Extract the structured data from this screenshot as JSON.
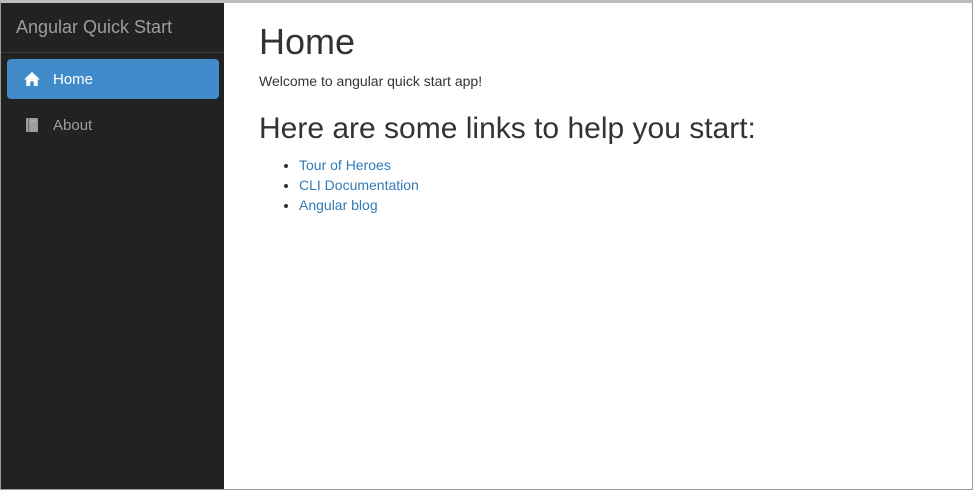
{
  "app": {
    "brand": "Angular Quick Start"
  },
  "sidebar": {
    "items": [
      {
        "label": "Home",
        "icon": "home-icon",
        "active": true
      },
      {
        "label": "About",
        "icon": "book-icon",
        "active": false
      }
    ]
  },
  "main": {
    "title": "Home",
    "welcome": "Welcome to angular quick start app!",
    "links_heading": "Here are some links to help you start:",
    "links": [
      {
        "label": "Tour of Heroes"
      },
      {
        "label": "CLI Documentation"
      },
      {
        "label": "Angular blog"
      }
    ]
  },
  "colors": {
    "sidebar_bg": "#222222",
    "active_bg": "#428bca",
    "link": "#337ab7",
    "text": "#333333",
    "muted": "#9d9d9d"
  }
}
